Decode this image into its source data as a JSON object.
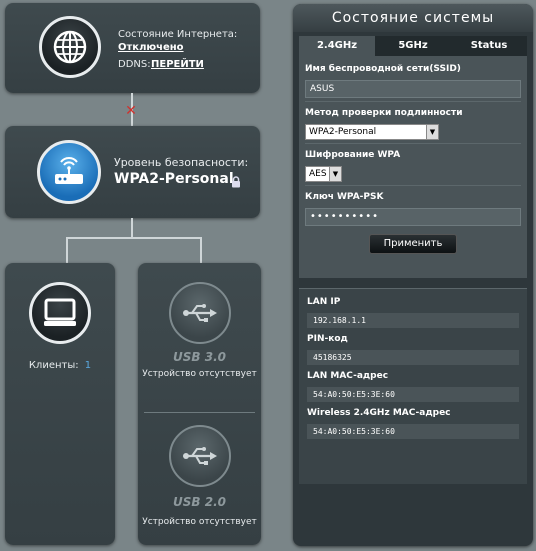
{
  "internet": {
    "status_label": "Состояние Интернета:",
    "status_value": "Отключено",
    "ddns_label": "DDNS:",
    "ddns_link": "ПЕРЕЙТИ"
  },
  "security": {
    "label": "Уровень безопасности:",
    "value": "WPA2-Personal"
  },
  "clients": {
    "label": "Клиенты:",
    "count": "1"
  },
  "usb3": {
    "title": "USB 3.0",
    "status": "Устройство отсутствует"
  },
  "usb2": {
    "title": "USB 2.0",
    "status": "Устройство отсутствует"
  },
  "system_status": {
    "title": "Состояние системы",
    "tabs": [
      "2.4GHz",
      "5GHz",
      "Status"
    ],
    "ssid_label": "Имя беспроводной сети(SSID)",
    "ssid_value": "ASUS",
    "auth_label": "Метод проверки подлинности",
    "auth_value": "WPA2-Personal",
    "enc_label": "Шифрование WPA",
    "enc_value": "AES",
    "psk_label": "Ключ WPA-PSK",
    "psk_value": "••••••••••",
    "apply_label": "Применить",
    "lan_ip_label": "LAN IP",
    "lan_ip_value": "192.168.1.1",
    "pin_label": "PIN-код",
    "pin_value": "45186325",
    "lan_mac_label": "LAN MAC-адрес",
    "lan_mac_value": "54:A0:50:E5:3E:60",
    "wl_mac_label": "Wireless 2.4GHz MAC-адрес",
    "wl_mac_value": "54:A0:50:E5:3E:60"
  },
  "colors": {
    "background": "#7a8588",
    "panel": "#3b4549",
    "security_blue": "#1a6db7",
    "disconnect_red": "#d0312d",
    "usb_label_gray": "#8d989c"
  }
}
